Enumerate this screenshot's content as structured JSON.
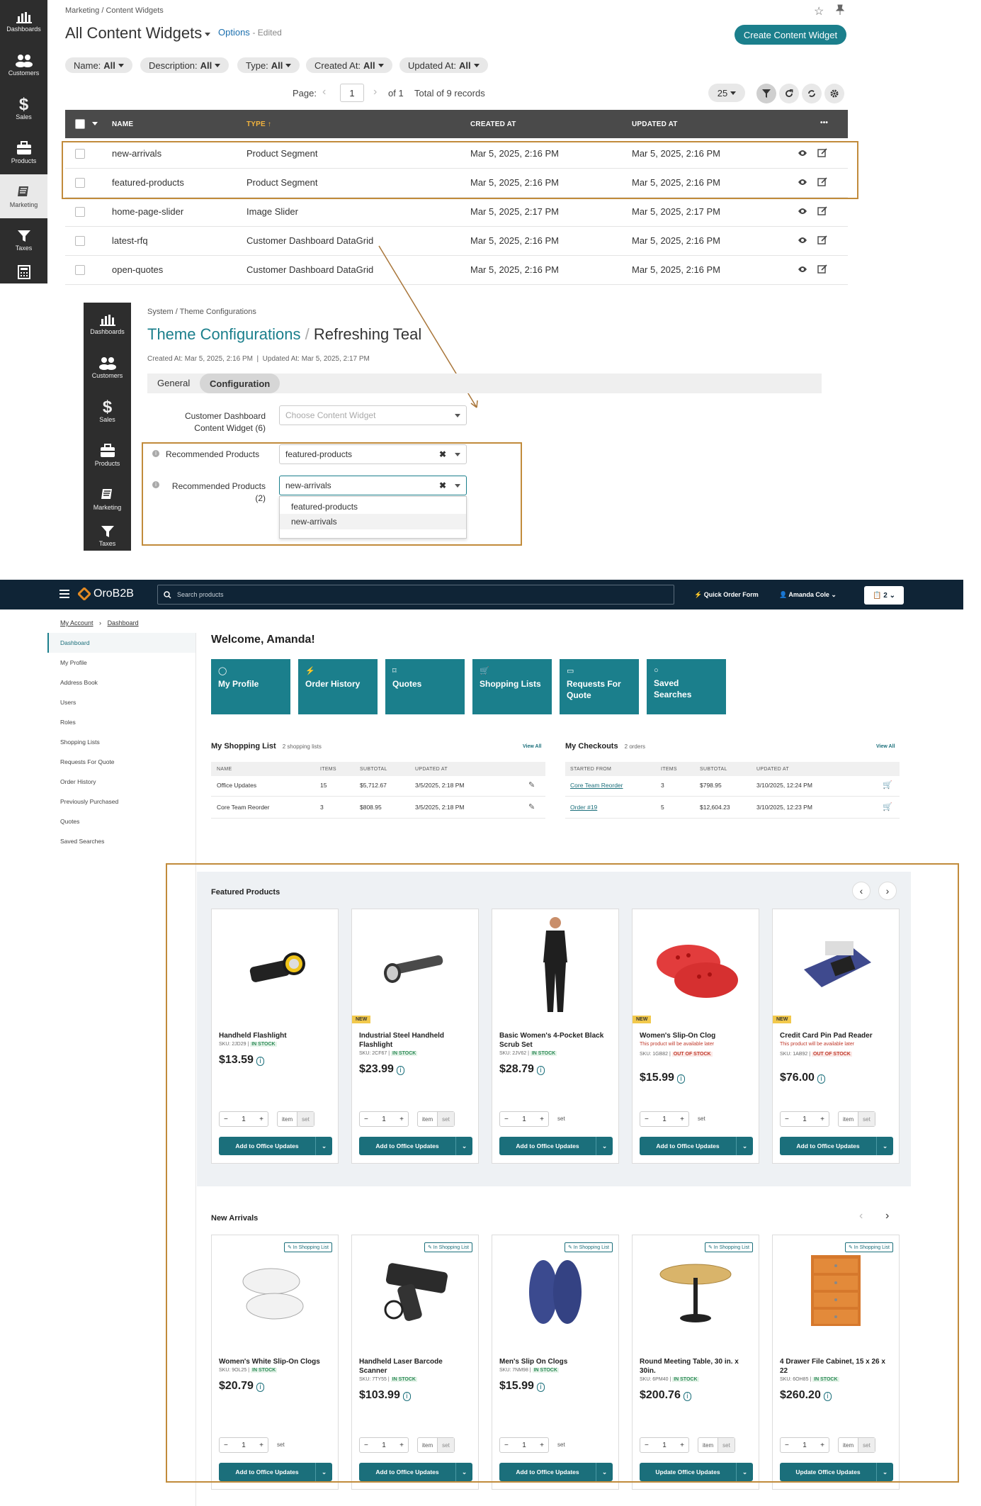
{
  "admin_sidebar_1": {
    "items": [
      "Dashboards",
      "Customers",
      "Sales",
      "Products",
      "Marketing",
      "Taxes"
    ]
  },
  "content_widgets": {
    "breadcrumb": "Marketing / Content Widgets",
    "title": "All Content Widgets",
    "options_label": "Options",
    "edited_label": "- Edited",
    "create_button": "Create Content Widget",
    "filters": [
      {
        "label": "Name:",
        "value": "All"
      },
      {
        "label": "Description:",
        "value": "All"
      },
      {
        "label": "Type:",
        "value": "All"
      },
      {
        "label": "Created At:",
        "value": "All"
      },
      {
        "label": "Updated At:",
        "value": "All"
      }
    ],
    "pager": {
      "page_label": "Page:",
      "page_value": "1",
      "of_label": "of 1",
      "total": "Total of 9 records",
      "per_page": "25"
    },
    "columns": {
      "name": "NAME",
      "type": "TYPE",
      "type_sort": "↑",
      "created": "CREATED AT",
      "updated": "UPDATED AT",
      "actions": "•••"
    },
    "rows": [
      {
        "name": "new-arrivals",
        "type": "Product Segment",
        "created": "Mar 5, 2025, 2:16 PM",
        "updated": "Mar 5, 2025, 2:16 PM"
      },
      {
        "name": "featured-products",
        "type": "Product Segment",
        "created": "Mar 5, 2025, 2:16 PM",
        "updated": "Mar 5, 2025, 2:16 PM"
      },
      {
        "name": "home-page-slider",
        "type": "Image Slider",
        "created": "Mar 5, 2025, 2:17 PM",
        "updated": "Mar 5, 2025, 2:17 PM"
      },
      {
        "name": "latest-rfq",
        "type": "Customer Dashboard DataGrid",
        "created": "Mar 5, 2025, 2:16 PM",
        "updated": "Mar 5, 2025, 2:16 PM"
      },
      {
        "name": "open-quotes",
        "type": "Customer Dashboard DataGrid",
        "created": "Mar 5, 2025, 2:16 PM",
        "updated": "Mar 5, 2025, 2:16 PM"
      }
    ]
  },
  "admin_sidebar_2": {
    "items": [
      "Dashboards",
      "Customers",
      "Sales",
      "Products",
      "Marketing",
      "Taxes"
    ]
  },
  "theme_config": {
    "breadcrumb": "System / Theme Configurations",
    "title_link": "Theme Configurations",
    "title_sep": "/",
    "title_name": "Refreshing Teal",
    "meta": "Created At: Mar 5, 2025, 2:16 PM  |  Updated At: Mar 5, 2025, 2:17 PM",
    "tabs": [
      "General",
      "Configuration"
    ],
    "fields": {
      "dashboard_label": "Customer Dashboard Content Widget (6)",
      "dashboard_placeholder": "Choose Content Widget",
      "rec1_label": "Recommended Products",
      "rec1_value": "featured-products",
      "rec2_label": "Recommended Products (2)",
      "rec2_value": "new-arrivals",
      "options": [
        "featured-products",
        "new-arrivals"
      ]
    }
  },
  "storefront": {
    "brand": "OroB2B",
    "search_placeholder": "Search products",
    "quick_order": "Quick Order Form",
    "user": "Amanda Cole",
    "cart_count": "2",
    "breadcrumb": [
      "My Account",
      "Dashboard"
    ],
    "side_nav": [
      "Dashboard",
      "My Profile",
      "Address Book",
      "Users",
      "Roles",
      "Shopping Lists",
      "Requests For Quote",
      "Order History",
      "Previously Purchased",
      "Quotes",
      "Saved Searches"
    ],
    "welcome": "Welcome, Amanda!",
    "tiles": [
      "My Profile",
      "Order History",
      "Quotes",
      "Shopping Lists",
      "Requests For Quote",
      "Saved Searches"
    ],
    "shopping_lists": {
      "title": "My Shopping List",
      "count": "2 shopping lists",
      "view_all": "View All",
      "headers": [
        "NAME",
        "ITEMS",
        "SUBTOTAL",
        "UPDATED AT"
      ],
      "rows": [
        [
          "Office Updates",
          "15",
          "$5,712.67",
          "3/5/2025, 2:18 PM"
        ],
        [
          "Core Team Reorder",
          "3",
          "$808.95",
          "3/5/2025, 2:18 PM"
        ]
      ]
    },
    "checkouts": {
      "title": "My Checkouts",
      "count": "2 orders",
      "view_all": "View All",
      "headers": [
        "STARTED FROM",
        "ITEMS",
        "SUBTOTAL",
        "UPDATED AT"
      ],
      "rows": [
        [
          "Core Team Reorder",
          "3",
          "$798.95",
          "3/10/2025, 12:24 PM"
        ],
        [
          "Order #19",
          "5",
          "$12,604.23",
          "3/10/2025, 12:23 PM"
        ]
      ]
    },
    "featured": {
      "title": "Featured Products",
      "items": [
        {
          "name": "Handheld Flashlight",
          "sku": "SKU: 2JD29 |",
          "stock": "IN STOCK",
          "price": "$13.59",
          "new": "",
          "note": "",
          "unit": "item",
          "unit2": "set"
        },
        {
          "name": "Industrial Steel Handheld Flashlight",
          "sku": "SKU: 2CF67 |",
          "stock": "IN STOCK",
          "price": "$23.99",
          "new": "NEW",
          "note": "",
          "unit": "item",
          "unit2": "set"
        },
        {
          "name": "Basic Women's 4-Pocket Black Scrub Set",
          "sku": "SKU: 2JV62 |",
          "stock": "IN STOCK",
          "price": "$28.79",
          "new": "",
          "note": "",
          "unit": "set",
          "unit2": ""
        },
        {
          "name": "Women's Slip-On Clog",
          "sku": "SKU: 1GB82 |",
          "stock": "OUT OF STOCK",
          "price": "$15.99",
          "new": "NEW",
          "note": "This product will be available later",
          "unit": "set",
          "unit2": ""
        },
        {
          "name": "Credit Card Pin Pad Reader",
          "sku": "SKU: 1AB92 |",
          "stock": "OUT OF STOCK",
          "price": "$76.00",
          "new": "NEW",
          "note": "This product will be available later",
          "unit": "item",
          "unit2": "set"
        }
      ],
      "add_label_prefix": "Add to ",
      "add_label_list": "Office Updates"
    },
    "arrivals": {
      "title": "New Arrivals",
      "in_list": "In Shopping List",
      "items": [
        {
          "name": "Women's White Slip-On Clogs",
          "sku": "SKU: 9OL25 |",
          "stock": "IN STOCK",
          "price": "$20.79",
          "unit": "set",
          "unit2": "",
          "btn": "Add to Office Updates"
        },
        {
          "name": "Handheld Laser Barcode Scanner",
          "sku": "SKU: 7TY55 |",
          "stock": "IN STOCK",
          "price": "$103.99",
          "unit": "item",
          "unit2": "set",
          "btn": "Add to Office Updates"
        },
        {
          "name": "Men's Slip On Clogs",
          "sku": "SKU: 7NM98 |",
          "stock": "IN STOCK",
          "price": "$15.99",
          "unit": "set",
          "unit2": "",
          "btn": "Add to Office Updates"
        },
        {
          "name": "Round Meeting Table, 30 in. x 30in.",
          "sku": "SKU: 6PM40 |",
          "stock": "IN STOCK",
          "price": "$200.76",
          "unit": "item",
          "unit2": "set",
          "btn": "Update Office Updates"
        },
        {
          "name": "4 Drawer File Cabinet, 15 x 26 x 22",
          "sku": "SKU: 6OH85 |",
          "stock": "IN STOCK",
          "price": "$260.20",
          "unit": "item",
          "unit2": "set",
          "btn": "Update Office Updates"
        }
      ]
    }
  },
  "colors": {
    "accent": "#1b7f8c",
    "highlight": "#c18b3b",
    "admin_dark": "#2d2d2d",
    "storefront_header": "#0f2436"
  }
}
